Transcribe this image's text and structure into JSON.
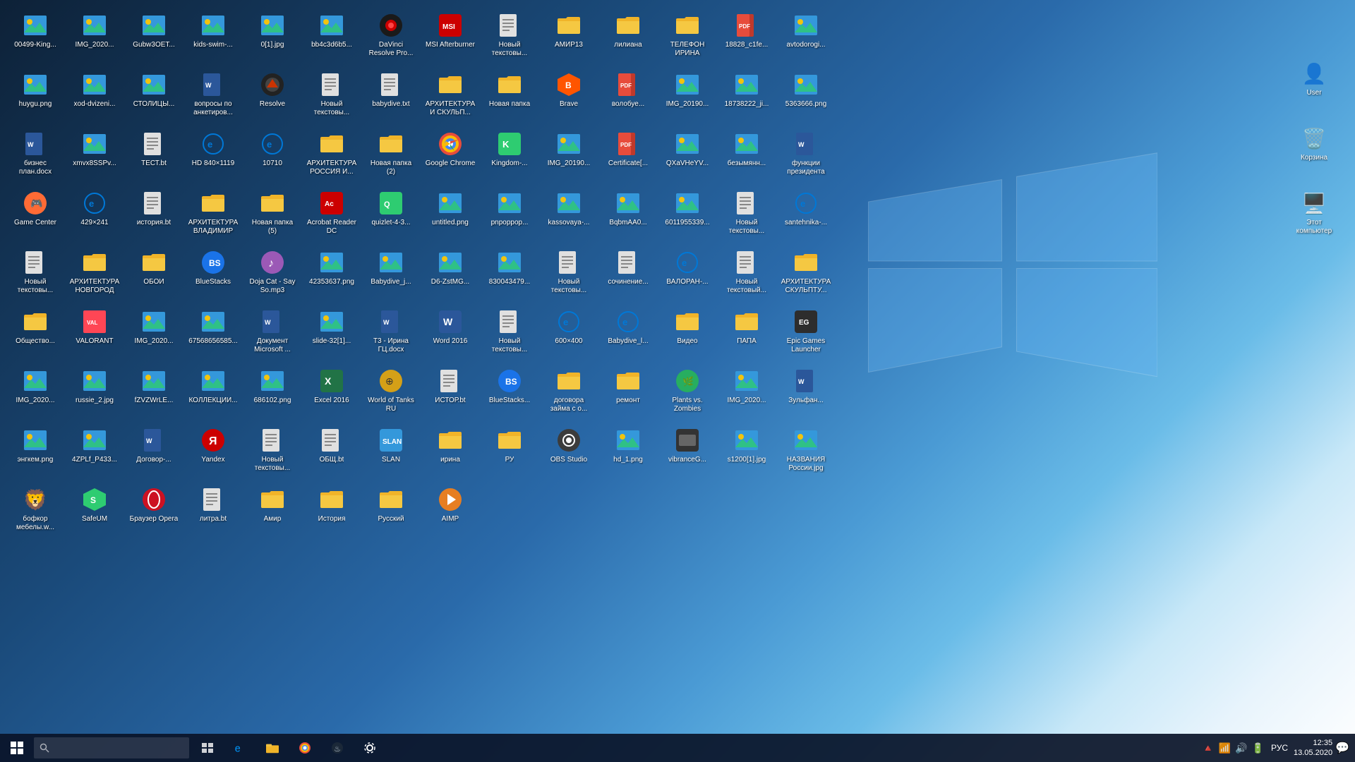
{
  "desktop": {
    "icons": [
      {
        "id": "00499",
        "label": "00499-King...",
        "type": "img",
        "emoji": "🖼️"
      },
      {
        "id": "IMG_2020_1",
        "label": "IMG_2020...",
        "type": "img",
        "emoji": "🖼️"
      },
      {
        "id": "gubw",
        "label": "Gubw3OET...",
        "type": "img",
        "emoji": "🖼️"
      },
      {
        "id": "kids",
        "label": "kids-swim-...",
        "type": "img",
        "emoji": "🖼️"
      },
      {
        "id": "0_1",
        "label": "0[1].jpg",
        "type": "img",
        "emoji": "🖼️"
      },
      {
        "id": "bb4c3d",
        "label": "bb4c3d6b5...",
        "type": "img",
        "emoji": "🖼️"
      },
      {
        "id": "davinci",
        "label": "DaVinci Resolve Pro...",
        "type": "app",
        "emoji": "🎬"
      },
      {
        "id": "msi",
        "label": "MSI Afterburner",
        "type": "app",
        "emoji": "🔥"
      },
      {
        "id": "new_txt1",
        "label": "Новый текстовы...",
        "type": "txt",
        "emoji": "📄"
      },
      {
        "id": "amir13",
        "label": "АМИР13",
        "type": "folder",
        "emoji": "📁"
      },
      {
        "id": "liliana",
        "label": "лилиана",
        "type": "folder",
        "emoji": "📁"
      },
      {
        "id": "tel_irina",
        "label": "ТЕЛЕФОН ИРИНА",
        "type": "folder",
        "emoji": "📁"
      },
      {
        "id": "18828",
        "label": "18828_c1fe...",
        "type": "pdf",
        "emoji": "📕"
      },
      {
        "id": "avtodorogi",
        "label": "avtodorogі...",
        "type": "img",
        "emoji": "🖼️"
      },
      {
        "id": "huygu",
        "label": "huygu.png",
        "type": "img",
        "emoji": "🖼️"
      },
      {
        "id": "xod_dvizeni",
        "label": "xod-dvizeni...",
        "type": "img",
        "emoji": "🖼️"
      },
      {
        "id": "stoliczi",
        "label": "СТОЛИЦЫ...",
        "type": "img",
        "emoji": "🖼️"
      },
      {
        "id": "voprosy",
        "label": "вопросы по анкетиров...",
        "type": "word",
        "emoji": "📘"
      },
      {
        "id": "resolve",
        "label": "Resolve",
        "type": "app",
        "emoji": "🎬"
      },
      {
        "id": "new_txt2",
        "label": "Новый текстовы...",
        "type": "txt",
        "emoji": "📄"
      },
      {
        "id": "babydive",
        "label": "babydive.txt",
        "type": "txt",
        "emoji": "📄"
      },
      {
        "id": "arxitektura_skulp",
        "label": "АРХИТЕКТУРА И СКУЛЬП...",
        "type": "folder",
        "emoji": "📁"
      },
      {
        "id": "novaya_papka",
        "label": "Новая папка",
        "type": "folder",
        "emoji": "📁"
      },
      {
        "id": "brave",
        "label": "Brave",
        "type": "app",
        "emoji": "🦁"
      },
      {
        "id": "volobuje",
        "label": "волобуе...",
        "type": "pdf",
        "emoji": "📕"
      },
      {
        "id": "IMG_2019_1",
        "label": "IMG_20190...",
        "type": "img",
        "emoji": "🖼️"
      },
      {
        "id": "18738222",
        "label": "18738222_ji...",
        "type": "img",
        "emoji": "🖼️"
      },
      {
        "id": "5363666",
        "label": "5363666.png",
        "type": "img",
        "emoji": "🖼️"
      },
      {
        "id": "biznes_plan",
        "label": "бизнес план.docx",
        "type": "word",
        "emoji": "📘"
      },
      {
        "id": "xmvx8SSPv",
        "label": "xmvx8SSPv...",
        "type": "img",
        "emoji": "🖼️"
      },
      {
        "id": "TEST",
        "label": "ТЕСТ.bt",
        "type": "txt",
        "emoji": "📄"
      },
      {
        "id": "HD840",
        "label": "HD 840×1119",
        "type": "app",
        "emoji": "🌐"
      },
      {
        "id": "10710",
        "label": "10710",
        "type": "app",
        "emoji": "🌐"
      },
      {
        "id": "arxitektura_rossiya",
        "label": "АРХИТЕКТУРА РОССИЯ И...",
        "type": "folder",
        "emoji": "📁"
      },
      {
        "id": "novaya_papka2",
        "label": "Новая папка (2)",
        "type": "folder",
        "emoji": "📁"
      },
      {
        "id": "google_chrome",
        "label": "Google Chrome",
        "type": "app",
        "emoji": "🌐"
      },
      {
        "id": "kingdom",
        "label": "Kingdom-...",
        "type": "app",
        "emoji": "🎮"
      },
      {
        "id": "IMG_2019_2",
        "label": "IMG_20190...",
        "type": "img",
        "emoji": "🖼️"
      },
      {
        "id": "certificate",
        "label": "Certificate[...",
        "type": "pdf",
        "emoji": "📕"
      },
      {
        "id": "qxavheyv",
        "label": "QXaVHeYV...",
        "type": "img",
        "emoji": "🖼️"
      },
      {
        "id": "bezymyan",
        "label": "безымянн...",
        "type": "img",
        "emoji": "🖼️"
      },
      {
        "id": "funktsii",
        "label": "функции президента",
        "type": "word",
        "emoji": "📘"
      },
      {
        "id": "game_center",
        "label": "Game Center",
        "type": "app",
        "emoji": "🎮"
      },
      {
        "id": "_429x241",
        "label": "429×241",
        "type": "app",
        "emoji": "🌐"
      },
      {
        "id": "istoriya",
        "label": "история.bt",
        "type": "txt",
        "emoji": "📄"
      },
      {
        "id": "arxitektura_vlad",
        "label": "АРХИТЕКТУРА ВЛАДИМИР",
        "type": "folder",
        "emoji": "📁"
      },
      {
        "id": "novaya_papka5",
        "label": "Новая папка (5)",
        "type": "folder",
        "emoji": "📁"
      },
      {
        "id": "acrobat",
        "label": "Acrobat Reader DC",
        "type": "app",
        "emoji": "📕"
      },
      {
        "id": "quizlet",
        "label": "quizlet-4-3...",
        "type": "app",
        "emoji": "🎮"
      },
      {
        "id": "untitled",
        "label": "untitled.png",
        "type": "img",
        "emoji": "🖼️"
      },
      {
        "id": "pnpoprop",
        "label": "pnpopроp...",
        "type": "img",
        "emoji": "🖼️"
      },
      {
        "id": "kassovaya",
        "label": "kassovaya-...",
        "type": "img",
        "emoji": "🖼️"
      },
      {
        "id": "bqbmaA40",
        "label": "BqbmAA0...",
        "type": "img",
        "emoji": "🖼️"
      },
      {
        "id": "6011955339",
        "label": "6011955339...",
        "type": "img",
        "emoji": "🖼️"
      },
      {
        "id": "new_txt3",
        "label": "Новый текстовы...",
        "type": "txt",
        "emoji": "📄"
      },
      {
        "id": "santehnika",
        "label": "santehnika-...",
        "type": "app",
        "emoji": "🌐"
      },
      {
        "id": "new_txt4",
        "label": "Новый текстовы...",
        "type": "txt",
        "emoji": "📄"
      },
      {
        "id": "arxitektura_novgorod",
        "label": "АРХИТЕКТУРА НОВГОРОД",
        "type": "folder",
        "emoji": "📁"
      },
      {
        "id": "oboi",
        "label": "ОБОИ",
        "type": "folder",
        "emoji": "📁"
      },
      {
        "id": "bluestacks",
        "label": "BlueStacks",
        "type": "app",
        "emoji": "📱"
      },
      {
        "id": "doja",
        "label": "Doja Cat - Say So.mp3",
        "type": "app",
        "emoji": "🎵"
      },
      {
        "id": "42353637",
        "label": "42353637.png",
        "type": "img",
        "emoji": "🖼️"
      },
      {
        "id": "babydive_j",
        "label": "Babydive_j...",
        "type": "img",
        "emoji": "🖼️"
      },
      {
        "id": "d6_zstmg",
        "label": "D6-ZstMG...",
        "type": "img",
        "emoji": "🖼️"
      },
      {
        "id": "830043479",
        "label": "830043479...",
        "type": "img",
        "emoji": "🖼️"
      },
      {
        "id": "new_txt5",
        "label": "Новый текстовы...",
        "type": "txt",
        "emoji": "📄"
      },
      {
        "id": "sochinenie",
        "label": "сочинение...",
        "type": "txt",
        "emoji": "📄"
      },
      {
        "id": "valorant_txt",
        "label": "ВАЛОРАН-...",
        "type": "app",
        "emoji": "🎮"
      },
      {
        "id": "new_txt6",
        "label": "Новый текстовый...",
        "type": "txt",
        "emoji": "📄"
      },
      {
        "id": "arxitektura_skulp2",
        "label": "АРХИТЕКТУРА СКУЛЬПТУ...",
        "type": "folder",
        "emoji": "📁"
      },
      {
        "id": "obshchestvo",
        "label": "Общество...",
        "type": "folder",
        "emoji": "📁"
      },
      {
        "id": "valorant",
        "label": "VALORANT",
        "type": "app",
        "emoji": "🎮"
      },
      {
        "id": "IMG_2020_2",
        "label": "IMG_2020...",
        "type": "img",
        "emoji": "🖼️"
      },
      {
        "id": "67568656",
        "label": "67568656585...",
        "type": "img",
        "emoji": "🖼️"
      },
      {
        "id": "dokument_ms",
        "label": "Документ Microsoft ...",
        "type": "word",
        "emoji": "📘"
      },
      {
        "id": "slide32",
        "label": "slide-32[1]...",
        "type": "img",
        "emoji": "🖼️"
      },
      {
        "id": "t3_irina",
        "label": "Т3 - Ирина ГЦ.docx",
        "type": "word",
        "emoji": "📘"
      },
      {
        "id": "word2016",
        "label": "Word 2016",
        "type": "app",
        "emoji": "📘"
      },
      {
        "id": "new_txt7",
        "label": "Новый текстовы...",
        "type": "txt",
        "emoji": "📄"
      },
      {
        "id": "_600x400",
        "label": "600×400",
        "type": "app",
        "emoji": "🌐"
      },
      {
        "id": "babydive_l",
        "label": "Babydive_l...",
        "type": "app",
        "emoji": "🌐"
      },
      {
        "id": "video",
        "label": "Видео",
        "type": "folder",
        "emoji": "📁"
      },
      {
        "id": "papa",
        "label": "ПАПА",
        "type": "folder",
        "emoji": "📁"
      },
      {
        "id": "epic_games",
        "label": "Epic Games Launcher",
        "type": "app",
        "emoji": "🎮"
      },
      {
        "id": "IMG_2020_3",
        "label": "IMG_2020...",
        "type": "img",
        "emoji": "🖼️"
      },
      {
        "id": "russie2",
        "label": "russie_2.jpg",
        "type": "img",
        "emoji": "🖼️"
      },
      {
        "id": "fzvzwrle",
        "label": "fZVZWrLE...",
        "type": "img",
        "emoji": "🖼️"
      },
      {
        "id": "kollekcii",
        "label": "КОЛЛЕКЦИИ...",
        "type": "img",
        "emoji": "🖼️"
      },
      {
        "id": "686102",
        "label": "686102.png",
        "type": "img",
        "emoji": "🖼️"
      },
      {
        "id": "excel2016",
        "label": "Excel 2016",
        "type": "app",
        "emoji": "📗"
      },
      {
        "id": "worldoftanks",
        "label": "World of Tanks RU",
        "type": "app",
        "emoji": "🎮"
      },
      {
        "id": "istor",
        "label": "ИСТОР.bt",
        "type": "txt",
        "emoji": "📄"
      },
      {
        "id": "bluestacks2",
        "label": "BlueStacks...",
        "type": "app",
        "emoji": "📱"
      },
      {
        "id": "dogovor",
        "label": "договора займа с о...",
        "type": "folder",
        "emoji": "📁"
      },
      {
        "id": "remont",
        "label": "ремонт",
        "type": "folder",
        "emoji": "📁"
      },
      {
        "id": "pvz",
        "label": "Plants vs. Zombies",
        "type": "app",
        "emoji": "🌿"
      },
      {
        "id": "IMG_2020_4",
        "label": "IMG_2020...",
        "type": "img",
        "emoji": "🖼️"
      },
      {
        "id": "zulfan",
        "label": "Зульфан...",
        "type": "word",
        "emoji": "📘"
      },
      {
        "id": "engkem",
        "label": "энгкем.png",
        "type": "img",
        "emoji": "🖼️"
      },
      {
        "id": "4ZPLf_P433",
        "label": "4ZPLf_P433...",
        "type": "img",
        "emoji": "🖼️"
      },
      {
        "id": "dogovor_r",
        "label": "Договор-...",
        "type": "word",
        "emoji": "📘"
      },
      {
        "id": "yandex",
        "label": "Yandex",
        "type": "app",
        "emoji": "🦊"
      },
      {
        "id": "new_txt8",
        "label": "Новый текстовы...",
        "type": "txt",
        "emoji": "📄"
      },
      {
        "id": "obsh",
        "label": "ОБЩ.bt",
        "type": "txt",
        "emoji": "📄"
      },
      {
        "id": "slan",
        "label": "SLAN",
        "type": "app",
        "emoji": "🖥️"
      },
      {
        "id": "irina_f",
        "label": "ирина",
        "type": "folder",
        "emoji": "📁"
      },
      {
        "id": "ry",
        "label": "РУ",
        "type": "folder",
        "emoji": "📁"
      },
      {
        "id": "obs",
        "label": "OBS Studio",
        "type": "app",
        "emoji": "🎥"
      },
      {
        "id": "hd1",
        "label": "hd_1.png",
        "type": "img",
        "emoji": "🖼️"
      },
      {
        "id": "vibrance",
        "label": "vibranceG...",
        "type": "app",
        "emoji": "🖥️"
      },
      {
        "id": "s1200_1",
        "label": "s1200[1].jpg",
        "type": "img",
        "emoji": "🖼️"
      },
      {
        "id": "nazvaniia",
        "label": "НАЗВАНИЯ России.jpg",
        "type": "img",
        "emoji": "🖼️"
      },
      {
        "id": "boscor",
        "label": "бофкор мебелы.w...",
        "type": "brave",
        "emoji": "🦁"
      },
      {
        "id": "safeup",
        "label": "SafeUM",
        "type": "app",
        "emoji": "🛡️"
      },
      {
        "id": "opera",
        "label": "Браузер Opera",
        "type": "app",
        "emoji": "🎭"
      },
      {
        "id": "litra",
        "label": "литра.bt",
        "type": "txt",
        "emoji": "📄"
      },
      {
        "id": "amir_f",
        "label": "Амир",
        "type": "folder",
        "emoji": "📁"
      },
      {
        "id": "istoriya_f",
        "label": "История",
        "type": "folder",
        "emoji": "📁"
      },
      {
        "id": "russky",
        "label": "Русский",
        "type": "folder",
        "emoji": "📁"
      },
      {
        "id": "aimp",
        "label": "AIMP",
        "type": "app",
        "emoji": "🎵"
      }
    ],
    "right_icons": [
      {
        "id": "user",
        "label": "User",
        "type": "folder",
        "emoji": "👤"
      },
      {
        "id": "korzina",
        "label": "Корзина",
        "type": "trash",
        "emoji": "🗑️"
      },
      {
        "id": "etot_pk",
        "label": "Этот компьютер",
        "type": "pc",
        "emoji": "🖥️"
      }
    ]
  },
  "taskbar": {
    "start_icon": "⊞",
    "search_placeholder": "🔍",
    "icons": [
      {
        "id": "task-view",
        "emoji": "⬛",
        "label": "Task View"
      },
      {
        "id": "edge",
        "emoji": "e",
        "label": "Microsoft Edge"
      },
      {
        "id": "explorer",
        "emoji": "📁",
        "label": "File Explorer"
      },
      {
        "id": "chrome",
        "emoji": "🌐",
        "label": "Google Chrome"
      },
      {
        "id": "steam",
        "emoji": "♨",
        "label": "Steam"
      },
      {
        "id": "settings",
        "emoji": "⚙",
        "label": "Settings"
      }
    ],
    "sys_icons": [
      "🔺",
      "🔊",
      "📶",
      "🔋"
    ],
    "lang": "РУС",
    "time": "12:35",
    "date": "13.05.2020",
    "notification": "🗨"
  }
}
